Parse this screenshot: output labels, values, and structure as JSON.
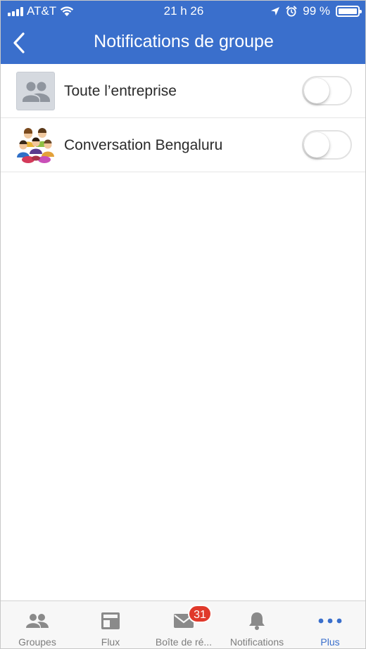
{
  "status_bar": {
    "carrier": "AT&T",
    "time": "21 h 26",
    "battery_text": "99 %",
    "battery_level": 0.99,
    "icons": [
      "signal-icon",
      "wifi-icon",
      "location-arrow-icon",
      "alarm-icon",
      "battery-icon"
    ]
  },
  "nav": {
    "title": "Notifications de groupe",
    "back_icon": "chevron-left-icon"
  },
  "groups": [
    {
      "label": "Toute l’entreprise",
      "avatar": "group-placeholder-icon",
      "enabled": false
    },
    {
      "label": "Conversation Bengaluru",
      "avatar": "people-illustration",
      "enabled": false
    }
  ],
  "tabs": [
    {
      "label": "Groupes",
      "icon": "groups-icon",
      "active": false
    },
    {
      "label": "Flux",
      "icon": "feed-icon",
      "active": false
    },
    {
      "label": "Boîte de ré...",
      "icon": "envelope-icon",
      "badge": "31",
      "active": false
    },
    {
      "label": "Notifications",
      "icon": "bell-icon",
      "active": false
    },
    {
      "label": "Plus",
      "icon": "more-dots-icon",
      "active": true
    }
  ],
  "colors": {
    "brand": "#3a6fcc",
    "badge": "#e0392b",
    "tab_inactive": "#7d7d7d"
  }
}
